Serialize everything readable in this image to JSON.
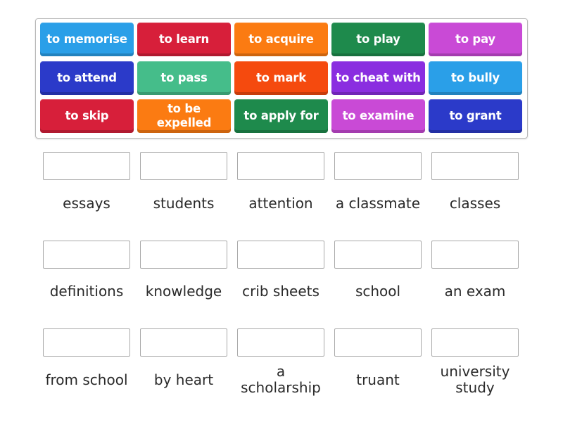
{
  "tiles": [
    {
      "label": "to memorise",
      "color": "#2a9fe8"
    },
    {
      "label": "to learn",
      "color": "#d71f3a"
    },
    {
      "label": "to acquire",
      "color": "#fb7b12"
    },
    {
      "label": "to play",
      "color": "#1e8a4c"
    },
    {
      "label": "to pay",
      "color": "#c94ad6"
    },
    {
      "label": "to attend",
      "color": "#2b3ac9"
    },
    {
      "label": "to pass",
      "color": "#45bd8a"
    },
    {
      "label": "to mark",
      "color": "#f54a0e"
    },
    {
      "label": "to cheat with",
      "color": "#8a2ee0"
    },
    {
      "label": "to bully",
      "color": "#2a9fe8"
    },
    {
      "label": "to skip",
      "color": "#d71f3a"
    },
    {
      "label": "to be expelled",
      "color": "#fb7b12"
    },
    {
      "label": "to apply for",
      "color": "#1e8a4c"
    },
    {
      "label": "to examine",
      "color": "#c94ad6"
    },
    {
      "label": "to grant",
      "color": "#2b3ac9"
    }
  ],
  "targets": [
    {
      "label": "essays"
    },
    {
      "label": "students"
    },
    {
      "label": "attention"
    },
    {
      "label": "a classmate"
    },
    {
      "label": "classes"
    },
    {
      "label": "definitions"
    },
    {
      "label": "knowledge"
    },
    {
      "label": "crib sheets"
    },
    {
      "label": "school"
    },
    {
      "label": "an exam"
    },
    {
      "label": "from school"
    },
    {
      "label": "by heart"
    },
    {
      "label": "a scholarship"
    },
    {
      "label": "truant"
    },
    {
      "label": "university study"
    }
  ]
}
